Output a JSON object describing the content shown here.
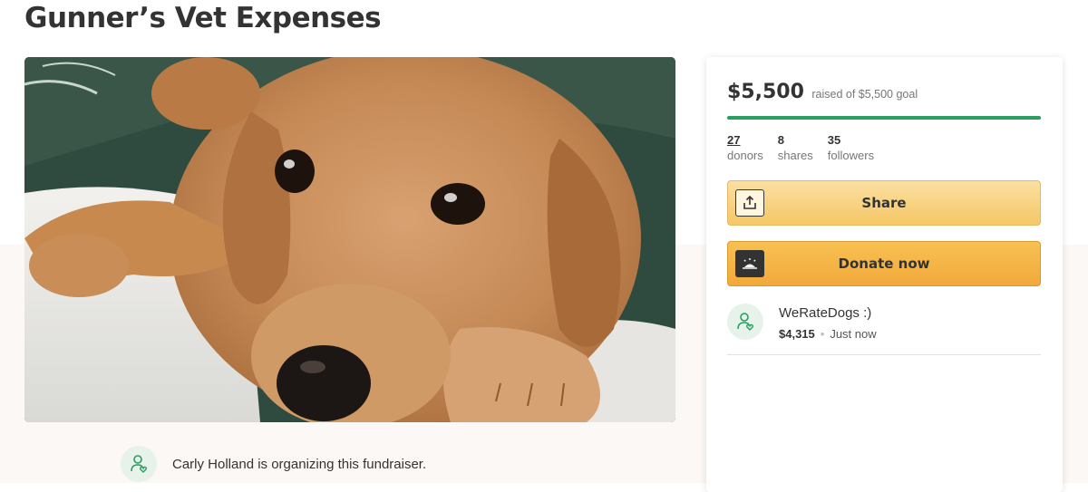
{
  "campaign": {
    "title": "Gunner’s Vet Expenses"
  },
  "photo": {
    "alt": "golden retriever puppy lying on a blanket",
    "icon": "campaign-photo"
  },
  "organizer": {
    "text": "Carly Holland is organizing this fundraiser.",
    "icon": "person-heart-icon"
  },
  "fundraiser": {
    "raised_amount": "$5,500",
    "raised_goal_text": "raised of $5,500 goal",
    "progress_fraction": 1.0,
    "progress_color": "#2a9d5f",
    "stats": [
      {
        "value": "27",
        "label": "donors"
      },
      {
        "value": "8",
        "label": "shares"
      },
      {
        "value": "35",
        "label": "followers"
      }
    ],
    "share_button": {
      "label": "Share",
      "icon": "share-upload-icon"
    },
    "donate_button": {
      "label": "Donate now",
      "icon": "sunrise-icon"
    },
    "recent_donation": {
      "name": "WeRateDogs :)",
      "amount": "$4,315",
      "time": "Just now",
      "icon": "person-heart-icon"
    }
  },
  "colors": {
    "accent_green": "#2a9d5f",
    "share_yellow": "#f5c766",
    "donate_orange": "#f2a93b"
  }
}
